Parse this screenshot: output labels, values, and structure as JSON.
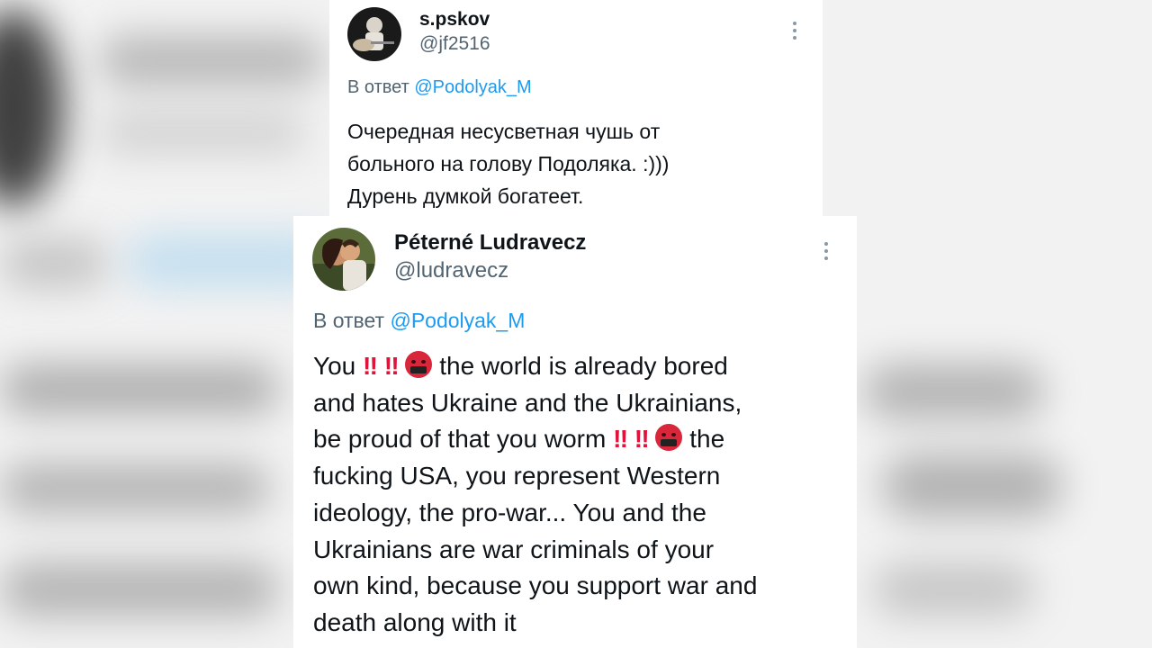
{
  "tweet1": {
    "name": "s.pskov",
    "handle": "@jf2516",
    "reply_prefix": "В ответ",
    "reply_to": "@Podolyak_M",
    "lines": [
      "Очередная несусветная чушь от",
      "больного на голову Подоляка. :)))",
      "Дурень думкой богатеет."
    ]
  },
  "tweet2": {
    "name": "Péterné Ludravecz",
    "handle": "@ludravecz",
    "reply_prefix": "В ответ",
    "reply_to": "@Podolyak_M",
    "line1_start": "You",
    "line1_end": " the world is already bored",
    "line2": "and hates Ukraine and the Ukrainians,",
    "line3_start": "be proud of that you worm",
    "line3_end": " the",
    "line4": "fucking USA, you represent Western",
    "line5": "ideology, the pro-war... You and the",
    "line6": "Ukrainians are war criminals of your",
    "line7": "own kind, because  you support war and",
    "line8": "death along with it",
    "emoji": {
      "double_exclamation": "‼",
      "face_icon": "face-with-symbols-on-mouth-icon"
    }
  }
}
